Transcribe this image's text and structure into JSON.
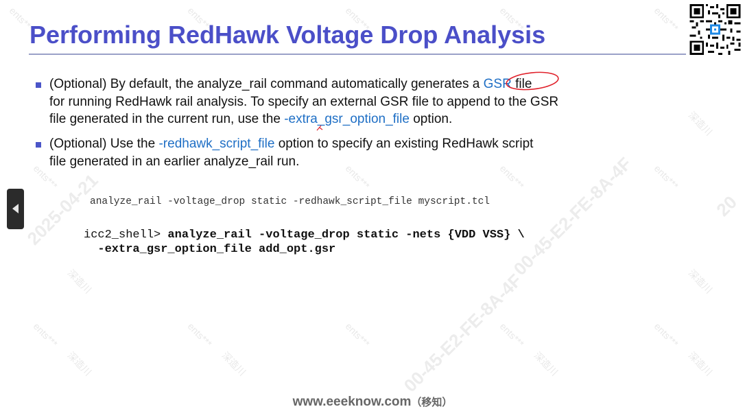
{
  "slide": {
    "title": "Performing RedHawk Voltage Drop Analysis",
    "bullets": [
      {
        "line1_a": "(Optional) By default, the analyze_rail command automatically generates a ",
        "line1_link": "GSR",
        "line1_b": " file",
        "line2": "for running RedHawk rail analysis. To specify an external GSR file to append to the GSR",
        "line3_a": "file generated in the current run, use the ",
        "line3_link": "-extra_gsr_option_file",
        "line3_b": " option."
      },
      {
        "line1_a": "(Optional) Use the ",
        "line1_link": "-redhawk_script_file",
        "line1_b": " option to specify an existing RedHawk script",
        "line2": "file generated in an earlier analyze_rail run."
      }
    ],
    "code_example_1": "analyze_rail -voltage_drop static -redhawk_script_file myscript.tcl",
    "code_example_2": {
      "prompt": "icc2_shell> ",
      "command_line1": "analyze_rail -voltage_drop static -nets {VDD VSS} \\",
      "command_line2": "  -extra_gsr_option_file add_opt.gsr"
    }
  },
  "footer": {
    "site": "www.eeeknow.com",
    "site_cn": "（移知）"
  },
  "watermarks": {
    "a": "ents***",
    "b": "深造川",
    "c": "00-45-E2-FE-8A-4F",
    "d": "2025-04-21",
    "e": "20"
  },
  "controls": {
    "prev_icon": "triangle-left-icon"
  },
  "colors": {
    "title": "#4b4fc8",
    "link": "#1f6fc5",
    "annotation": "#e0202a"
  }
}
